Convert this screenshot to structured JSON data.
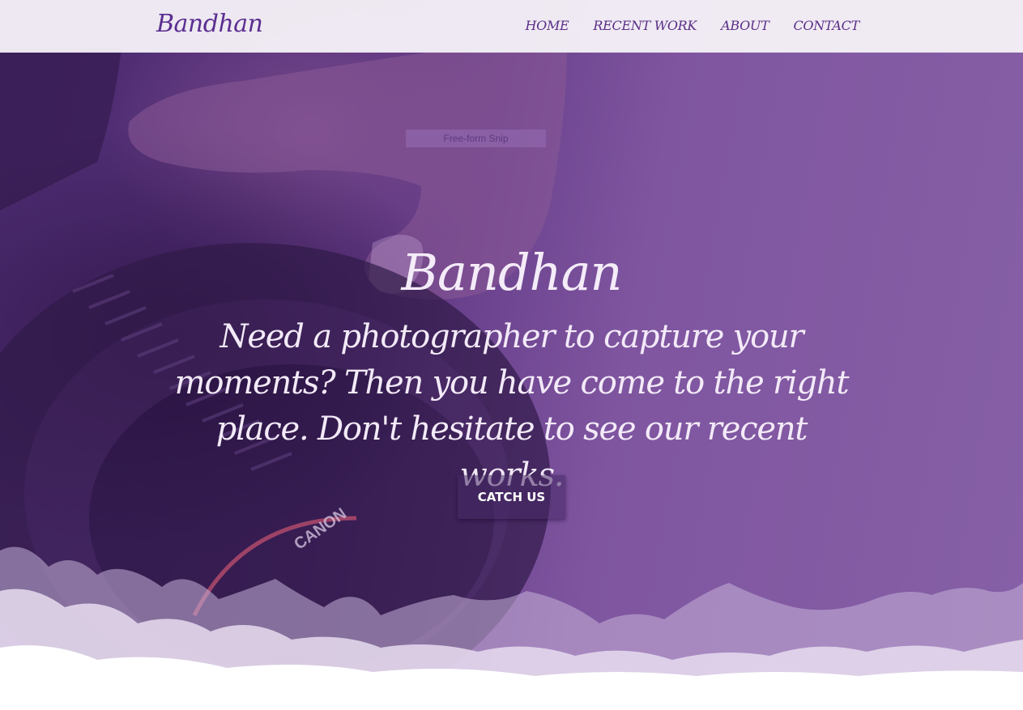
{
  "navbar": {
    "brand": "Bandhan",
    "items": [
      {
        "label": "HOME"
      },
      {
        "label": "RECENT WORK"
      },
      {
        "label": "ABOUT"
      },
      {
        "label": "CONTACT"
      }
    ]
  },
  "overlay": {
    "snip_label": "Free-form Snip"
  },
  "hero": {
    "title": "Bandhan",
    "subtitle": "Need a photographer to capture your moments? Then you have come to the right place. Don't hesitate to see our recent works.",
    "cta_label": "CATCH US",
    "lens_text": "CANON"
  },
  "colors": {
    "brand": "#5b2e91",
    "overlay_purple": "#7f55a0",
    "text_light": "#f4ecf8"
  }
}
